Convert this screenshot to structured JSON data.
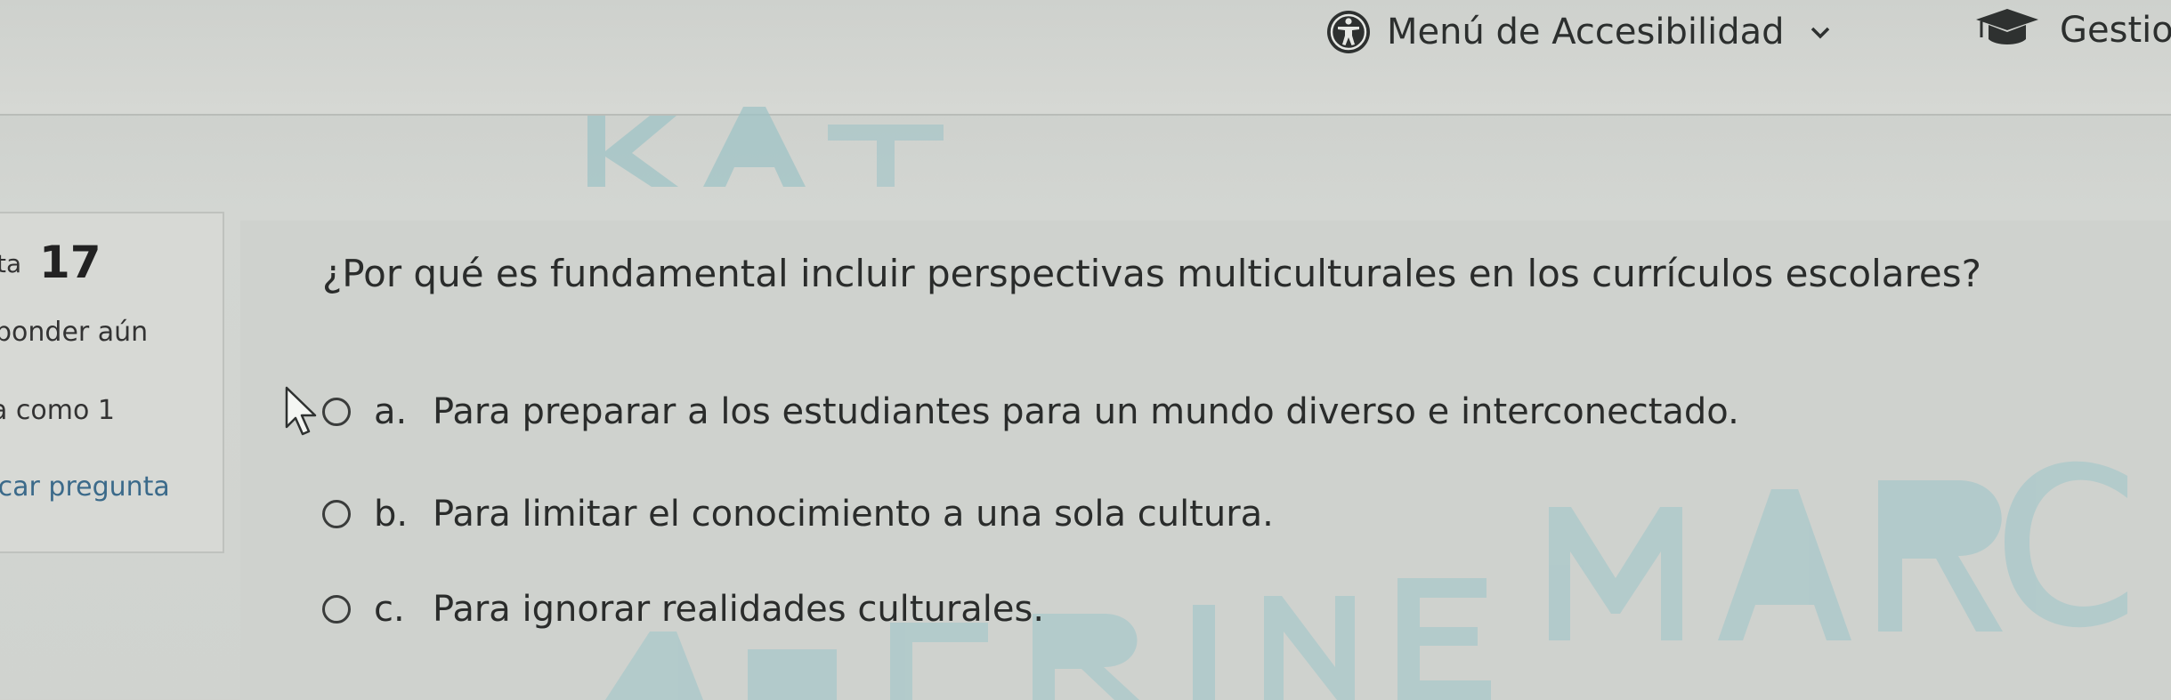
{
  "header": {
    "accessibility_menu_label": "Menú de Accesibilidad",
    "manage_label": "Gestio"
  },
  "question_info": {
    "prefix": "ta",
    "number": "17",
    "status": "ponder aún",
    "marks": "a como 1",
    "flag_label": "rcar pregunta"
  },
  "question": {
    "text": "¿Por qué es fundamental incluir perspectivas multiculturales en los currículos escolares?",
    "options": [
      {
        "letter": "a.",
        "text": "Para preparar a los estudiantes para un mundo diverso e interconectado."
      },
      {
        "letter": "b.",
        "text": "Para limitar el conocimiento a una sola cultura."
      },
      {
        "letter": "c.",
        "text": "Para ignorar realidades culturales."
      }
    ]
  },
  "colors": {
    "watermark": "#9fc3c6",
    "text": "#2a2c2b",
    "link": "#3b6a8a"
  }
}
